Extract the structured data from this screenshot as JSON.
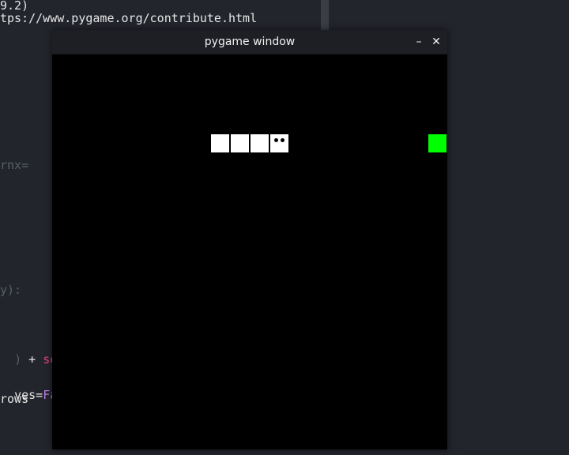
{
  "terminal": {
    "lines": [
      "9.2)",
      "tps://www.pygame.org/contribute.html",
      "rnx=",
      "y):",
      "ves=",
      "rows"
    ],
    "highlight_fal": "Fal",
    "highlight_se": "se",
    "prefix_code": ")",
    "plus": "+"
  },
  "window": {
    "title": "pygame window",
    "minimize_glyph": "–",
    "close_glyph": "✕"
  },
  "game": {
    "snake_color": "#ffffff",
    "food_color": "#00ff00",
    "background": "#000000",
    "snake_length": 4
  }
}
